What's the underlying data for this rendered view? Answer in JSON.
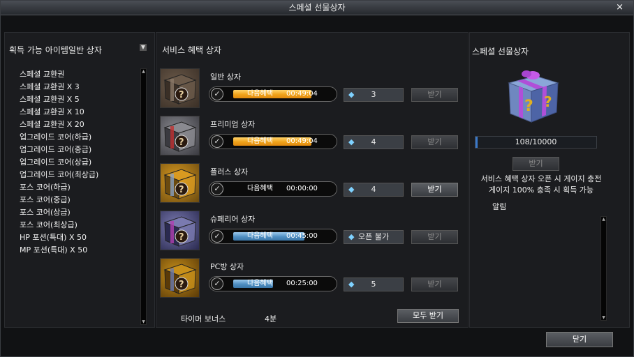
{
  "window": {
    "title": "스페셜 선물상자",
    "close_label": "×"
  },
  "left": {
    "header": "획득 가능 아이템일반 상자",
    "dropdown_glyph": "▼",
    "items": [
      "스페셜 교환권",
      "스페셜 교환권 X 3",
      "스페셜 교환권 X 5",
      "스페셜 교환권 X 10",
      "스페셜 교환권 X 20",
      "업그레이드 코어(하급)",
      "업그레이드 코어(중급)",
      "업그레이드 코어(상급)",
      "업그레이드 코어(최상급)",
      "포스 코어(하급)",
      "포스 코어(중급)",
      "포스 코어(상급)",
      "포스 코어(최상급)",
      "HP 포션(특대) X 50",
      "MP 포션(특대) X 50"
    ]
  },
  "service": {
    "header": "서비스 혜택 상자",
    "boxes": [
      {
        "name": "일반 상자",
        "timer_label": "다음혜택",
        "time": "00:49:04",
        "gems": "3",
        "receive": "받기",
        "fill_pct": 82
      },
      {
        "name": "프리미엄 상자",
        "timer_label": "다음혜택",
        "time": "00:49:04",
        "gems": "4",
        "receive": "받기",
        "fill_pct": 82
      },
      {
        "name": "플러스 상자",
        "timer_label": "다음혜택",
        "time": "00:00:00",
        "gems": "4",
        "receive": "받기",
        "fill_pct": 0
      },
      {
        "name": "슈페리어 상자",
        "timer_label": "다음혜택",
        "time": "00:45:00",
        "gems": "오픈 불가",
        "receive": "받기",
        "fill_pct": 75
      },
      {
        "name": "PC방 상자",
        "timer_label": "다음혜택",
        "time": "00:25:00",
        "gems": "5",
        "receive": "받기",
        "fill_pct": 42
      }
    ],
    "bonus_label": "타이머 보너스",
    "bonus_value": "4분",
    "receive_all": "모두 받기"
  },
  "special": {
    "header": "스페셜 선물상자",
    "progress_text": "108/10000",
    "progress_fraction": 0.0108,
    "receive": "받기",
    "desc_line1": "서비스 혜택 상자 오픈 시 게이지 충전",
    "desc_line2": "게이지 100% 충족 시 획득 가능",
    "alarm_label": "알림"
  },
  "footer": {
    "close": "닫기"
  },
  "colors": {
    "timer_orange": "#f0a21a",
    "timer_blue": "#4f8fc2",
    "gem": "#7fd2ff",
    "progress": "#3a78c9"
  }
}
